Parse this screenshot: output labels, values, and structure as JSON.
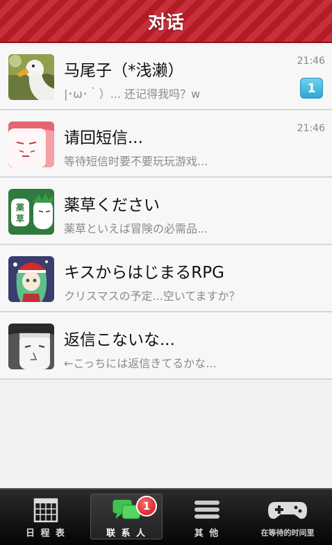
{
  "header": {
    "title": "对话"
  },
  "conversations": [
    {
      "name": "马尾子（*浅濑）",
      "preview": "|･ω･｀）... 还记得我吗？w",
      "time": "21:46",
      "unread": "1",
      "avatar_icon": "duck-avatar-icon"
    },
    {
      "name": "请回短信...",
      "preview": "等待短信时要不要玩玩游戏...",
      "time": "21:46",
      "avatar_icon": "santa-face-avatar-icon"
    },
    {
      "name": "薬草ください",
      "preview": "薬草といえば冒険の必需品...",
      "avatar_icon": "herb-avatar-icon"
    },
    {
      "name": "キスからはじまるRPG",
      "preview": "クリスマスの予定...空いてますか？",
      "avatar_icon": "anime-girl-avatar-icon"
    },
    {
      "name": "返信こないな...",
      "preview": "←こっちには返信きてるかな...",
      "avatar_icon": "sad-face-avatar-icon"
    }
  ],
  "tabs": [
    {
      "label": "日 程 表",
      "icon": "calendar-icon"
    },
    {
      "label": "联 系 人",
      "icon": "chat-bubbles-icon",
      "badge": "1",
      "active": true
    },
    {
      "label": "其 他",
      "icon": "menu-icon"
    },
    {
      "label": "在等待的时间里",
      "icon": "gamepad-icon"
    }
  ],
  "colors": {
    "header_red": "#b31c25",
    "badge_blue": "#2da6d4",
    "tab_bg": "#1a1a1a",
    "active_green": "#3fc24f"
  }
}
